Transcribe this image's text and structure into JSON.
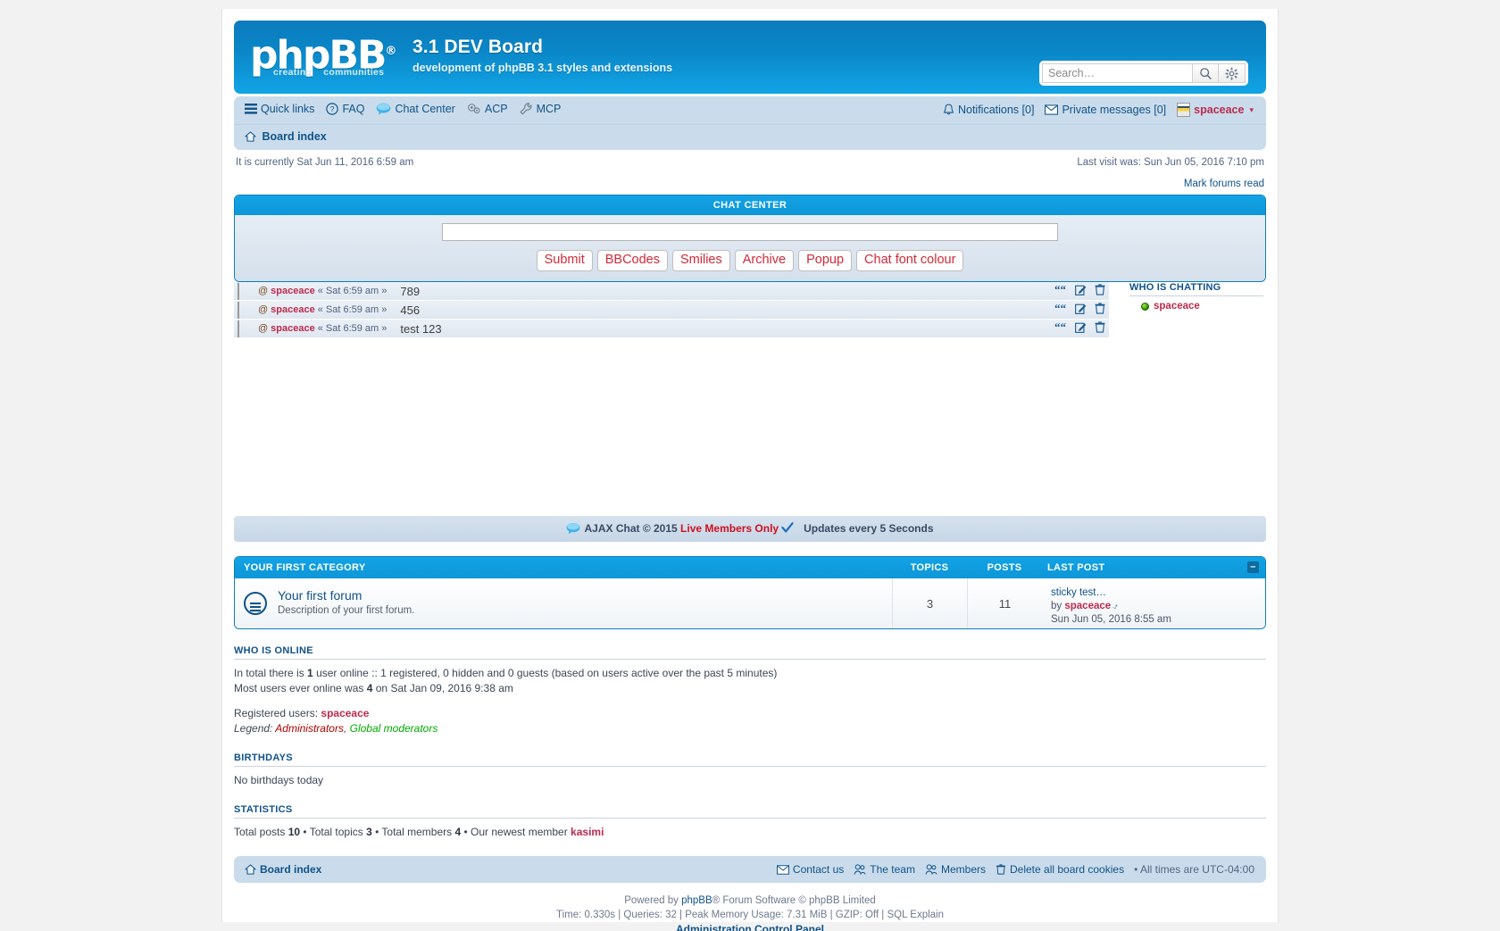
{
  "header": {
    "logo_text": "phpBB",
    "logo_reg": "®",
    "tagline_left": "creating",
    "tagline_right": "communities",
    "site_title": "3.1 DEV Board",
    "site_description": "development of phpBB 3.1 styles and extensions",
    "search": {
      "placeholder": "Search…",
      "value": "",
      "search_icon": "search-icon",
      "advanced_icon": "gear-icon"
    },
    "colors": {
      "header_top": "#0b7bbd",
      "header_bottom": "#11a4e6",
      "accent": "#105289",
      "user_red": "#bc2a4d"
    }
  },
  "nav": {
    "left_items": [
      {
        "label": "Quick links",
        "icon": "hamburger-icon"
      },
      {
        "label": "FAQ",
        "icon": "question-circle-icon"
      },
      {
        "label": "Chat Center",
        "icon": "speech-bubble-icon"
      },
      {
        "label": "ACP",
        "icon": "cogs-icon"
      },
      {
        "label": "MCP",
        "icon": "wrench-icon"
      }
    ],
    "right_items": [
      {
        "label": "Notifications [0]",
        "icon": "bell-icon"
      },
      {
        "label": "Private messages [0]",
        "icon": "envelope-icon"
      }
    ],
    "username": "spaceace",
    "user_caret": "▾",
    "user_avatar_icon": "user-avatar-icon"
  },
  "breadcrumb": {
    "home_icon": "home-icon",
    "label": "Board index"
  },
  "timebar": {
    "current": "It is currently Sat Jun 11, 2016 6:59 am",
    "last_visit": "Last visit was: Sun Jun 05, 2016 7:10 pm",
    "mark_read": "Mark forums read"
  },
  "chat": {
    "title": "CHAT CENTER",
    "input_value": "",
    "input_placeholder": "",
    "buttons": [
      {
        "label": "Submit"
      },
      {
        "label": "BBCodes"
      },
      {
        "label": "Smilies"
      },
      {
        "label": "Archive"
      },
      {
        "label": "Popup"
      },
      {
        "label": "Chat font colour"
      }
    ],
    "messages": [
      {
        "at": "@",
        "user": "spaceace",
        "time": "« Sat 6:59 am »",
        "text": "789"
      },
      {
        "at": "@",
        "user": "spaceace",
        "time": "« Sat 6:59 am »",
        "text": "456"
      },
      {
        "at": "@",
        "user": "spaceace",
        "time": "« Sat 6:59 am »",
        "text": "test 123"
      }
    ],
    "row_actions": [
      {
        "icon": "quote-icon",
        "name": "quote-message-button"
      },
      {
        "icon": "edit-icon",
        "name": "edit-message-button"
      },
      {
        "icon": "trash-icon",
        "name": "delete-message-button"
      }
    ],
    "who_is_chatting": {
      "title": "WHO IS CHATTING",
      "users": [
        {
          "name": "spaceace",
          "status": "online"
        }
      ]
    },
    "footer": {
      "icon": "speech-bubble-icon",
      "brand": "AJAX Chat © 2015 ",
      "highlight": "Live Members Only",
      "check_icon": "check-icon",
      "updates": "Updates every 5 Seconds"
    }
  },
  "forums": {
    "category": "YOUR FIRST CATEGORY",
    "columns": {
      "topics": "TOPICS",
      "posts": "POSTS",
      "last_post": "LAST POST"
    },
    "collapse_icon": "minus-icon",
    "rows": [
      {
        "icon": "forum-folder-icon",
        "title": "Your first forum",
        "description": "Description of your first forum.",
        "topics": "3",
        "posts": "11",
        "last_post_title": "sticky test…",
        "last_post_by_label": "by",
        "last_post_author": "spaceace",
        "last_post_jump_icon": "goto-post-icon",
        "last_post_date": "Sun Jun 05, 2016 8:55 am"
      }
    ]
  },
  "who_online": {
    "title": "WHO IS ONLINE",
    "line1_a": "In total there is ",
    "line1_count": "1",
    "line1_b": " user online :: 1 registered, 0 hidden and 0 guests (based on users active over the past 5 minutes)",
    "line2_a": "Most users ever online was ",
    "line2_count": "4",
    "line2_b": " on Sat Jan 09, 2016 9:38 am",
    "registered_label": "Registered users: ",
    "registered_users": "spaceace",
    "legend_label": "Legend: ",
    "legend_admins": "Administrators",
    "legend_sep": ", ",
    "legend_gmods": "Global moderators"
  },
  "birthdays": {
    "title": "BIRTHDAYS",
    "text": "No birthdays today"
  },
  "statistics": {
    "title": "STATISTICS",
    "posts_label": "Total posts ",
    "posts": "10",
    "sep1": " • Total topics ",
    "topics": "3",
    "sep2": " • Total members ",
    "members": "4",
    "sep3": " • Our newest member ",
    "newest_member": "kasimi"
  },
  "bottom_nav": {
    "home_icon": "home-icon",
    "home_label": "Board index",
    "items": [
      {
        "label": "Contact us",
        "icon": "envelope-icon"
      },
      {
        "label": "The team",
        "icon": "users-icon"
      },
      {
        "label": "Members",
        "icon": "users-icon"
      },
      {
        "label": "Delete all board cookies",
        "icon": "trash-icon"
      }
    ],
    "timezone": "• All times are UTC-04:00"
  },
  "footer": {
    "powered_a": "Powered by ",
    "powered_brand": "phpBB",
    "powered_b": "® Forum Software © phpBB Limited",
    "stats": "Time: 0.330s | Queries: 32 | Peak Memory Usage: 7.31 MiB | GZIP: Off | SQL Explain",
    "acp": "Administration Control Panel"
  }
}
